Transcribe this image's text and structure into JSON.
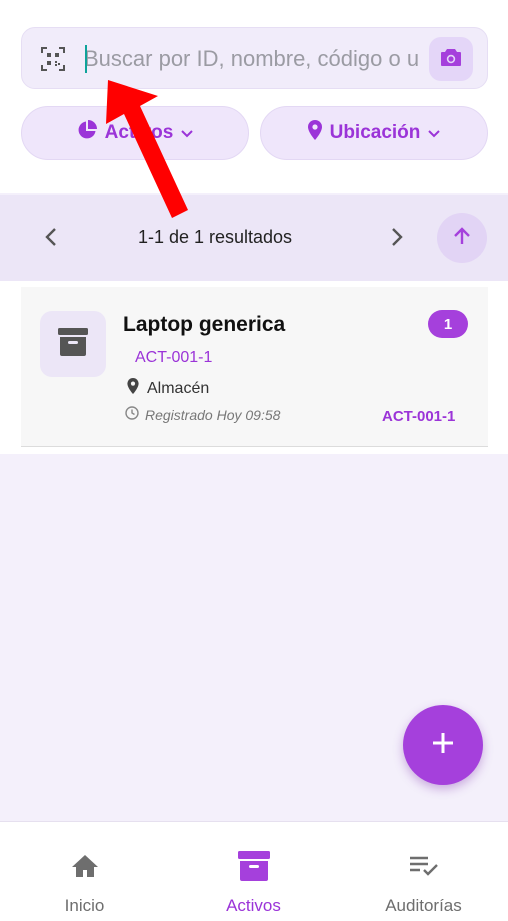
{
  "search": {
    "placeholder": "Buscar por ID, nombre, código o u",
    "qr_icon": "qr-scan-icon",
    "camera_icon": "camera-icon"
  },
  "filters": [
    {
      "label": "Activos",
      "icon": "pie-chart-icon"
    },
    {
      "label": "Ubicación",
      "icon": "location-pin-icon"
    }
  ],
  "pagination": {
    "text": "1-1 de 1 resultados"
  },
  "assets": [
    {
      "name": "Laptop generica",
      "code": "ACT-001-1",
      "location": "Almacén",
      "registered": "Registrado Hoy 09:58",
      "badge": "1",
      "ref": "ACT-001-1",
      "icon": "archive-box-icon"
    }
  ],
  "nav": {
    "items": [
      {
        "label": "Inicio",
        "icon": "home-icon",
        "active": false
      },
      {
        "label": "Activos",
        "icon": "archive-box-icon",
        "active": true
      },
      {
        "label": "Auditorías",
        "icon": "checklist-icon",
        "active": false
      }
    ]
  },
  "colors": {
    "accent": "#a540dc",
    "accent_text": "#9b34d8",
    "annotation_arrow": "#ff0000"
  }
}
